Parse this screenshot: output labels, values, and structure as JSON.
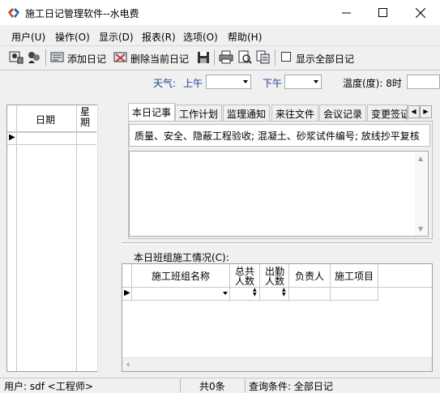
{
  "window": {
    "title": "施工日记管理软件--水电费",
    "minimize_icon": "minimize-icon",
    "maximize_icon": "maximize-icon",
    "close_icon": "close-icon"
  },
  "menu": [
    {
      "label": "用户(U)"
    },
    {
      "label": "操作(O)"
    },
    {
      "label": "显示(D)"
    },
    {
      "label": "报表(R)"
    },
    {
      "label": "选项(O)"
    },
    {
      "label": "帮助(H)"
    }
  ],
  "toolbar": {
    "add_label": "添加日记",
    "delete_label": "删除当前日记",
    "show_all_label": "显示全部日记",
    "show_all_checked": false
  },
  "weather": {
    "label": "天气:",
    "am_label": "上午",
    "am_value": "",
    "pm_label": "下午",
    "pm_value": "",
    "temp_label": "温度(度): 8时",
    "temp_value": ""
  },
  "left_grid": {
    "col_date": "日期",
    "col_week": "星期",
    "row_indicator": "▶"
  },
  "tabs": [
    {
      "label": "本日记事",
      "active": true
    },
    {
      "label": "工作计划",
      "active": false
    },
    {
      "label": "监理通知",
      "active": false
    },
    {
      "label": "来往文件",
      "active": false
    },
    {
      "label": "会议记录",
      "active": false
    },
    {
      "label": "变更签证",
      "active": false
    }
  ],
  "diary": {
    "categories": "质量、安全、隐蔽工程验收; 混凝土、砂浆试件编号; 放线抄平复核",
    "content": ""
  },
  "crew": {
    "label": "本日班组施工情况(C):",
    "columns": [
      "施工班组名称",
      "总共人数",
      "出勤人数",
      "负责人",
      "施工项目"
    ],
    "row_indicator": "▶"
  },
  "status": {
    "user": "用户: sdf <工程师>",
    "count": "共0条",
    "query": "查询条件: 全部日记"
  },
  "colors": {
    "accent_blue": "#1e3c99",
    "title_bg": "#ffffff",
    "panel_bg": "#f0f0f0"
  }
}
